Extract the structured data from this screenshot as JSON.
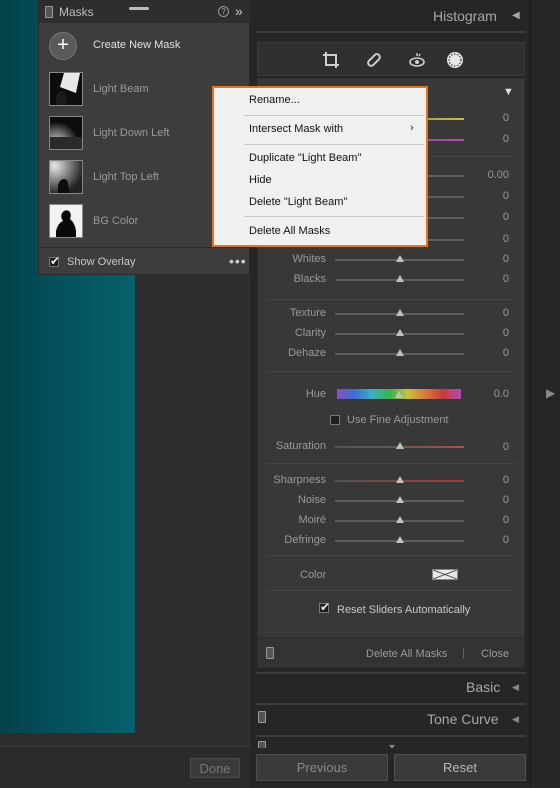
{
  "masks_panel": {
    "title": "Masks",
    "create_label": "Create New Mask",
    "items": [
      {
        "label": "Light Beam"
      },
      {
        "label": "Light Down Left"
      },
      {
        "label": "Light Top Left"
      },
      {
        "label": "BG Color"
      }
    ],
    "show_overlay_label": "Show Overlay",
    "show_overlay_checked": true
  },
  "context_menu": {
    "items": [
      {
        "label": "Rename..."
      },
      {
        "label": "Intersect Mask with",
        "submenu": true
      },
      {
        "label": "Duplicate \"Light Beam\""
      },
      {
        "label": "Hide"
      },
      {
        "label": "Delete \"Light Beam\""
      },
      {
        "label": "Delete All Masks"
      }
    ],
    "highlight_color": "#e8731f"
  },
  "canvas": {
    "done_label": "Done",
    "photo_color": "#045460"
  },
  "right_panel": {
    "histogram_title": "Histogram",
    "sliders_top": [
      {
        "label": "",
        "value": "0"
      },
      {
        "label": "",
        "value": "0"
      },
      {
        "label": "",
        "value": "0.00"
      },
      {
        "label": "",
        "value": "0"
      },
      {
        "label": "",
        "value": "0"
      },
      {
        "label": "",
        "value": "0"
      },
      {
        "label": "Whites",
        "value": "0"
      },
      {
        "label": "Blacks",
        "value": "0"
      }
    ],
    "sliders_presence": [
      {
        "label": "Texture",
        "value": "0"
      },
      {
        "label": "Clarity",
        "value": "0"
      },
      {
        "label": "Dehaze",
        "value": "0"
      }
    ],
    "hue": {
      "label": "Hue",
      "value": "0.0"
    },
    "fine_adjust_label": "Use Fine Adjustment",
    "saturation": {
      "label": "Saturation",
      "value": "0"
    },
    "sliders_detail": [
      {
        "label": "Sharpness",
        "value": "0"
      },
      {
        "label": "Noise",
        "value": "0"
      },
      {
        "label": "Moiré",
        "value": "0"
      },
      {
        "label": "Defringe",
        "value": "0"
      }
    ],
    "color_label": "Color",
    "reset_sliders_label": "Reset Sliders Automatically",
    "reset_sliders_checked": true,
    "delete_all_label": "Delete All Masks",
    "close_label": "Close",
    "basic_title": "Basic",
    "tone_curve_title": "Tone Curve",
    "previous_label": "Previous",
    "reset_label": "Reset"
  }
}
